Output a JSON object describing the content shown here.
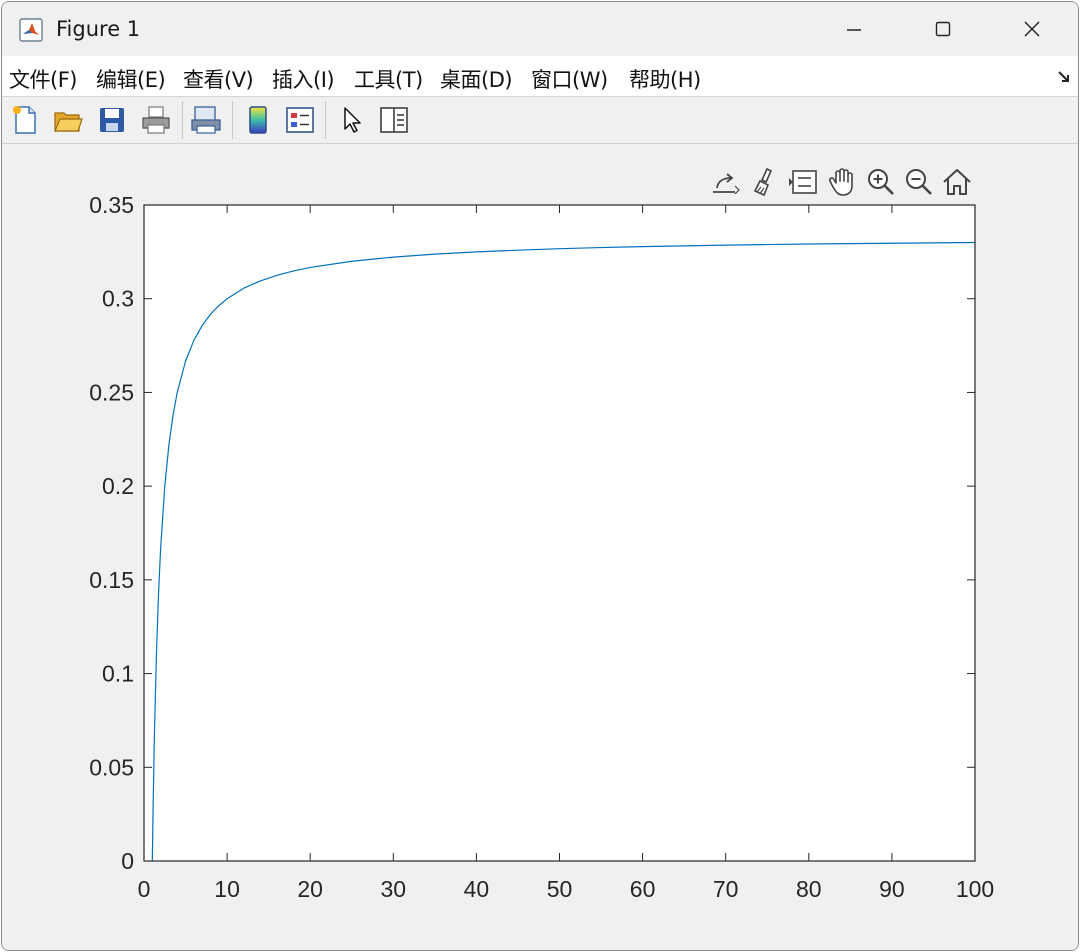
{
  "window": {
    "title": "Figure 1",
    "app_icon": "matlab-icon",
    "controls": [
      "minimize-icon",
      "maximize-icon",
      "close-icon"
    ]
  },
  "menu": {
    "items": [
      "文件(F)",
      "编辑(E)",
      "查看(V)",
      "插入(I)",
      "工具(T)",
      "桌面(D)",
      "窗口(W)",
      "帮助(H)"
    ],
    "overflow_icon": "dock-arrow-icon"
  },
  "toolbar": {
    "buttons": [
      "new-figure-icon",
      "open-file-icon",
      "save-icon",
      "print-icon",
      "print-preview-icon",
      "colorbar-icon",
      "legend-icon",
      "edit-plot-icon",
      "property-inspector-icon"
    ]
  },
  "axes_toolbar": {
    "buttons": [
      "export-icon",
      "brush-icon",
      "data-tips-icon",
      "pan-icon",
      "zoom-in-icon",
      "zoom-out-icon",
      "restore-view-icon"
    ]
  },
  "colors": {
    "line": "#0072bd",
    "axes_bg": "#ffffff",
    "figure_bg": "#f0f0f0",
    "axis": "#262626"
  },
  "chart_data": {
    "type": "line",
    "title": "",
    "xlabel": "",
    "ylabel": "",
    "xlim": [
      0,
      100
    ],
    "ylim": [
      0,
      0.35
    ],
    "xticks": [
      0,
      10,
      20,
      30,
      40,
      50,
      60,
      70,
      80,
      90,
      100
    ],
    "xtick_labels": [
      "0",
      "10",
      "20",
      "30",
      "40",
      "50",
      "60",
      "70",
      "80",
      "90",
      "100"
    ],
    "yticks": [
      0,
      0.05,
      0.1,
      0.15,
      0.2,
      0.25,
      0.3,
      0.35
    ],
    "ytick_labels": [
      "0",
      "0.05",
      "0.1",
      "0.15",
      "0.2",
      "0.25",
      "0.3",
      "0.35"
    ],
    "grid": false,
    "legend": "none",
    "series": [
      {
        "x": [
          1,
          1.1,
          1.25,
          1.5,
          1.75,
          2,
          2.5,
          3,
          3.5,
          4,
          5,
          6,
          7,
          8,
          9,
          10,
          12,
          14,
          16,
          18,
          20,
          25,
          30,
          35,
          40,
          45,
          50,
          55,
          60,
          65,
          70,
          75,
          80,
          85,
          90,
          95,
          100
        ],
        "y": [
          0,
          0.0303,
          0.0667,
          0.1111,
          0.1429,
          0.1667,
          0.2,
          0.2222,
          0.2381,
          0.25,
          0.2667,
          0.2778,
          0.2857,
          0.2917,
          0.2963,
          0.3,
          0.3056,
          0.3095,
          0.3125,
          0.3148,
          0.3167,
          0.32,
          0.3222,
          0.3238,
          0.325,
          0.3259,
          0.3267,
          0.3273,
          0.3278,
          0.3282,
          0.3286,
          0.3289,
          0.3292,
          0.3294,
          0.3296,
          0.3298,
          0.33
        ]
      }
    ]
  }
}
